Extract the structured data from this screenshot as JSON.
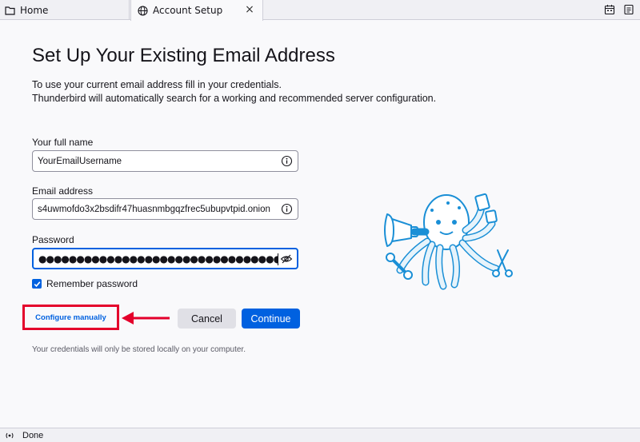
{
  "tabs": {
    "home": {
      "label": "Home",
      "icon": "folder-icon"
    },
    "account": {
      "label": "Account Setup",
      "icon": "globe-icon",
      "close": "×"
    }
  },
  "toolbar": {
    "icons": [
      "calendar-icon",
      "address-book-icon"
    ]
  },
  "page": {
    "title": "Set Up Your Existing Email Address",
    "desc_line1": "To use your current email address fill in your credentials.",
    "desc_line2": "Thunderbird will automatically search for a working and recommended server configuration."
  },
  "form": {
    "fullname_label": "Your full name",
    "fullname_value": "YourEmailUsername",
    "email_label": "Email address",
    "email_value": "s4uwmofdo3x2bsdifr47huasnmbgqzfrec5ubupvtpid.onion",
    "password_label": "Password",
    "password_value": "●●●●●●●●●●●●●●●●●●●●●●●●●●●●●●●●●●●",
    "remember_label": "Remember password",
    "remember_checked": true
  },
  "actions": {
    "configure_manually": "Configure manually",
    "cancel": "Cancel",
    "continue": "Continue"
  },
  "note": "Your credentials will only be stored locally on your computer.",
  "status": {
    "text": "Done"
  },
  "colors": {
    "accent": "#0061e0",
    "highlight": "#e4002b",
    "mascot_blue": "#1a8fd6"
  }
}
